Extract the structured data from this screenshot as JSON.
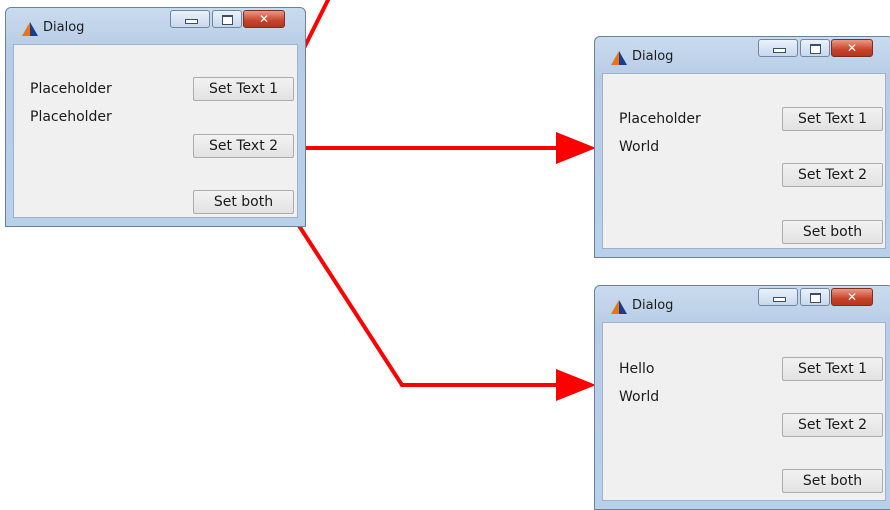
{
  "colors": {
    "arrow": "#ff0000",
    "titlebar": "#c9dbee",
    "close": "#c9432b",
    "client": "#f0f0f0"
  },
  "dialogs": [
    {
      "title": "Dialog",
      "icon": "app-triangle-icon",
      "labels": [
        "Placeholder",
        "Placeholder"
      ],
      "buttons": [
        "Set Text 1",
        "Set Text 2",
        "Set both"
      ]
    },
    {
      "title": "Dialog",
      "icon": "app-triangle-icon",
      "labels": [
        "Placeholder",
        "World"
      ],
      "buttons": [
        "Set Text 1",
        "Set Text 2",
        "Set both"
      ]
    },
    {
      "title": "Dialog",
      "icon": "app-triangle-icon",
      "labels": [
        "Hello",
        "World"
      ],
      "buttons": [
        "Set Text 1",
        "Set Text 2",
        "Set both"
      ]
    }
  ],
  "window_controls": {
    "minimize": "minimize-icon",
    "maximize": "maximize-icon",
    "close": "close-icon"
  }
}
